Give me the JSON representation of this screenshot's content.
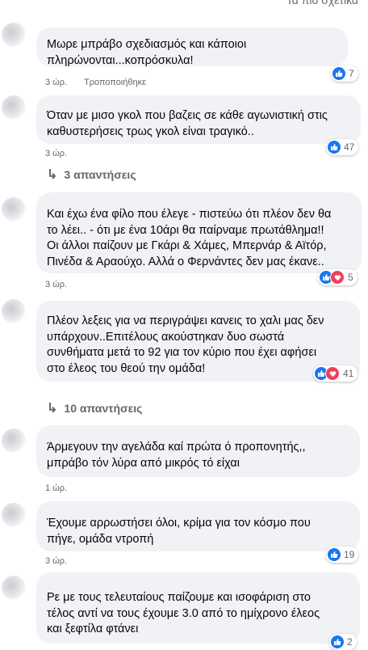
{
  "header": {
    "sort_label": "Τα πιο σχετικά"
  },
  "comments": [
    {
      "author": "",
      "text": [
        "Μωρε μπράβο σχεδιασμός και κάποιοι",
        "πληρώνονται...κοπρόσκυλα!"
      ],
      "time": "3 ώρ.",
      "edited": "Τροποποιήθηκε",
      "reactions": {
        "count": "7",
        "love": false
      }
    },
    {
      "author": "",
      "text": [
        "Όταν με μισο γκολ που βαζεις σε κάθε αγωνιστική στις",
        "καθυστερήσεις τρως γκολ είναι τραγικό.."
      ],
      "time": "3 ώρ.",
      "reactions": {
        "count": "47",
        "love": false
      },
      "replies": "3 απαντήσεις"
    },
    {
      "author": "",
      "text": [
        "Και έχω ένα φίλο που έλεγε - πιστεύω ότι πλέον δεν θα",
        "το λέει.. - ότι με ένα 10άρι θα παίρναμε πρωτάθλημα!!",
        "Οι άλλοι παίζουν με Γκάρι & Χάμες, Μπερνάρ & Αϊτόρ,",
        "Πινέδα & Αραούχο. Αλλά ο Φερνάντες δεν μας έκανε.."
      ],
      "time": "3 ώρ.",
      "reactions": {
        "count": "5",
        "love": true
      }
    },
    {
      "author": "",
      "text": [
        "Πλέον λεξεις για να περιγράψει κανεις το χαλι μας δεν",
        "υπάρχουν..Επιτέλους ακούστηκαν δυο σωστά",
        "συνθήματα μετά το 92 για τον κύριο που έχει αφήσει",
        "στο έλεος του θεού την ομάδα!"
      ],
      "reactions": {
        "count": "41",
        "love": true
      },
      "replies": "10 απαντήσεις"
    },
    {
      "author": "",
      "text": [
        "Άρμεγουν την αγελάδα καί πρώτα ό προπονητής,,",
        "μπράβο τόν λύρα από μικρός τό είχαι"
      ],
      "time": "1 ώρ."
    },
    {
      "author": "",
      "text": [
        "Έχουμε αρρωστήσει όλοι, κρίμα για τον κόσμο που",
        "πήγε, ομάδα ντροπή"
      ],
      "time": "3 ώρ.",
      "reactions": {
        "count": "19",
        "love": false
      }
    },
    {
      "author": "",
      "text": [
        "Ρε με τους τελευταίους παίζουμε και ισοφάριση στο",
        "τέλος αντί να τους έχουμε 3.0 από το ημίχρονο έλεος",
        "και ξεφτίλα φτάνει"
      ],
      "reactions": {
        "count": "2",
        "love": false
      }
    }
  ],
  "colors": {
    "like": "#1877f2",
    "love": "#f33e58",
    "bubble": "#f0f2f5",
    "meta": "#65676b"
  }
}
